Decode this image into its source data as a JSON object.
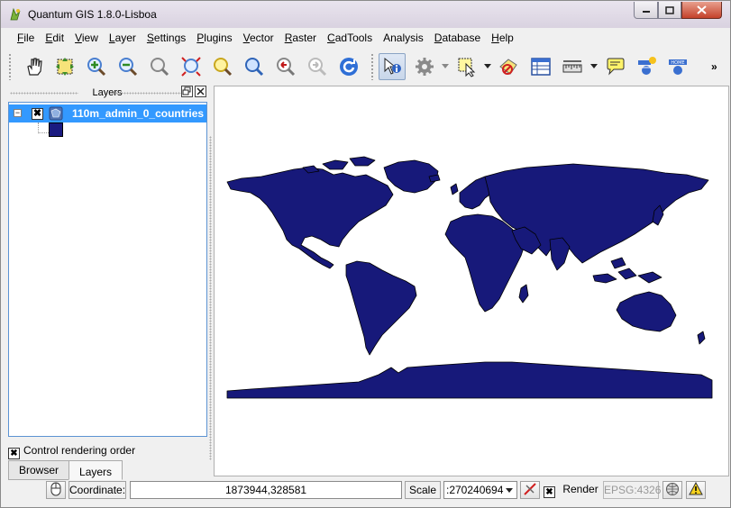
{
  "window": {
    "title": "Quantum GIS 1.8.0-Lisboa"
  },
  "menubar": {
    "items": [
      {
        "u": "F",
        "rest": "ile"
      },
      {
        "u": "E",
        "rest": "dit"
      },
      {
        "u": "V",
        "rest": "iew"
      },
      {
        "u": "L",
        "rest": "ayer"
      },
      {
        "u": "S",
        "rest": "ettings"
      },
      {
        "u": "P",
        "rest": "lugins"
      },
      {
        "u": "V",
        "rest": "ector"
      },
      {
        "u": "R",
        "rest": "aster"
      },
      {
        "u": "C",
        "rest": "adTools"
      },
      {
        "u": "",
        "rest": "Analysis"
      },
      {
        "u": "D",
        "rest": "atabase"
      },
      {
        "u": "H",
        "rest": "elp"
      }
    ]
  },
  "toolbar": {
    "tools": [
      "pan-icon",
      "zoom-selection-icon",
      "zoom-in-icon",
      "zoom-out-icon",
      "zoom-layer-icon",
      "zoom-full-icon",
      "zoom-selected-icon",
      "zoom-native-icon",
      "zoom-last-icon",
      "zoom-next-icon",
      "refresh-icon",
      "identify-icon",
      "actions-icon",
      "select-icon",
      "deselect-icon",
      "attribute-table-icon",
      "measure-icon",
      "map-tips-icon",
      "new-bookmark-icon",
      "show-bookmarks-icon"
    ],
    "more": "»"
  },
  "layers_panel": {
    "title": "Layers",
    "layer_name": "110m_admin_0_countries",
    "expand_symbol": "−",
    "check_symbol": "✖",
    "swatch_color": "#1a1a80",
    "render_order_label": "Control rendering order",
    "tabs": [
      "Browser",
      "Layers"
    ]
  },
  "map": {
    "fill_color": "#17197a"
  },
  "statusbar": {
    "coordinate_label": "Coordinate:",
    "coordinate_value": "1873944,328581",
    "scale_label": "Scale",
    "scale_value": ":270240694",
    "render_label": "Render",
    "crs_label": "EPSG:4326"
  }
}
